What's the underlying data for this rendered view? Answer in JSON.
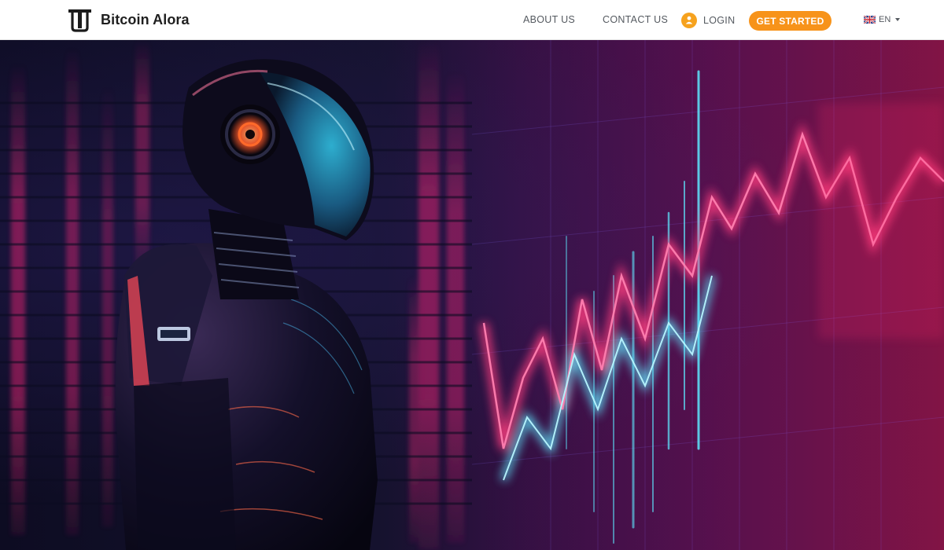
{
  "brand": {
    "name": "Bitcoin Alora",
    "logo_icon": "brand-logo-icon"
  },
  "nav": {
    "about": "ABOUT US",
    "contact": "CONTACT US",
    "login": "LOGIN",
    "login_icon": "user-icon",
    "cta": "GET STARTED",
    "language": "EN",
    "language_flag": "uk-flag-icon"
  },
  "hero": {
    "image": "robot-trading-chart-illustration"
  },
  "colors": {
    "accent": "#f7931a",
    "nav_bg": "#ffffff",
    "nav_text": "#555a60"
  }
}
